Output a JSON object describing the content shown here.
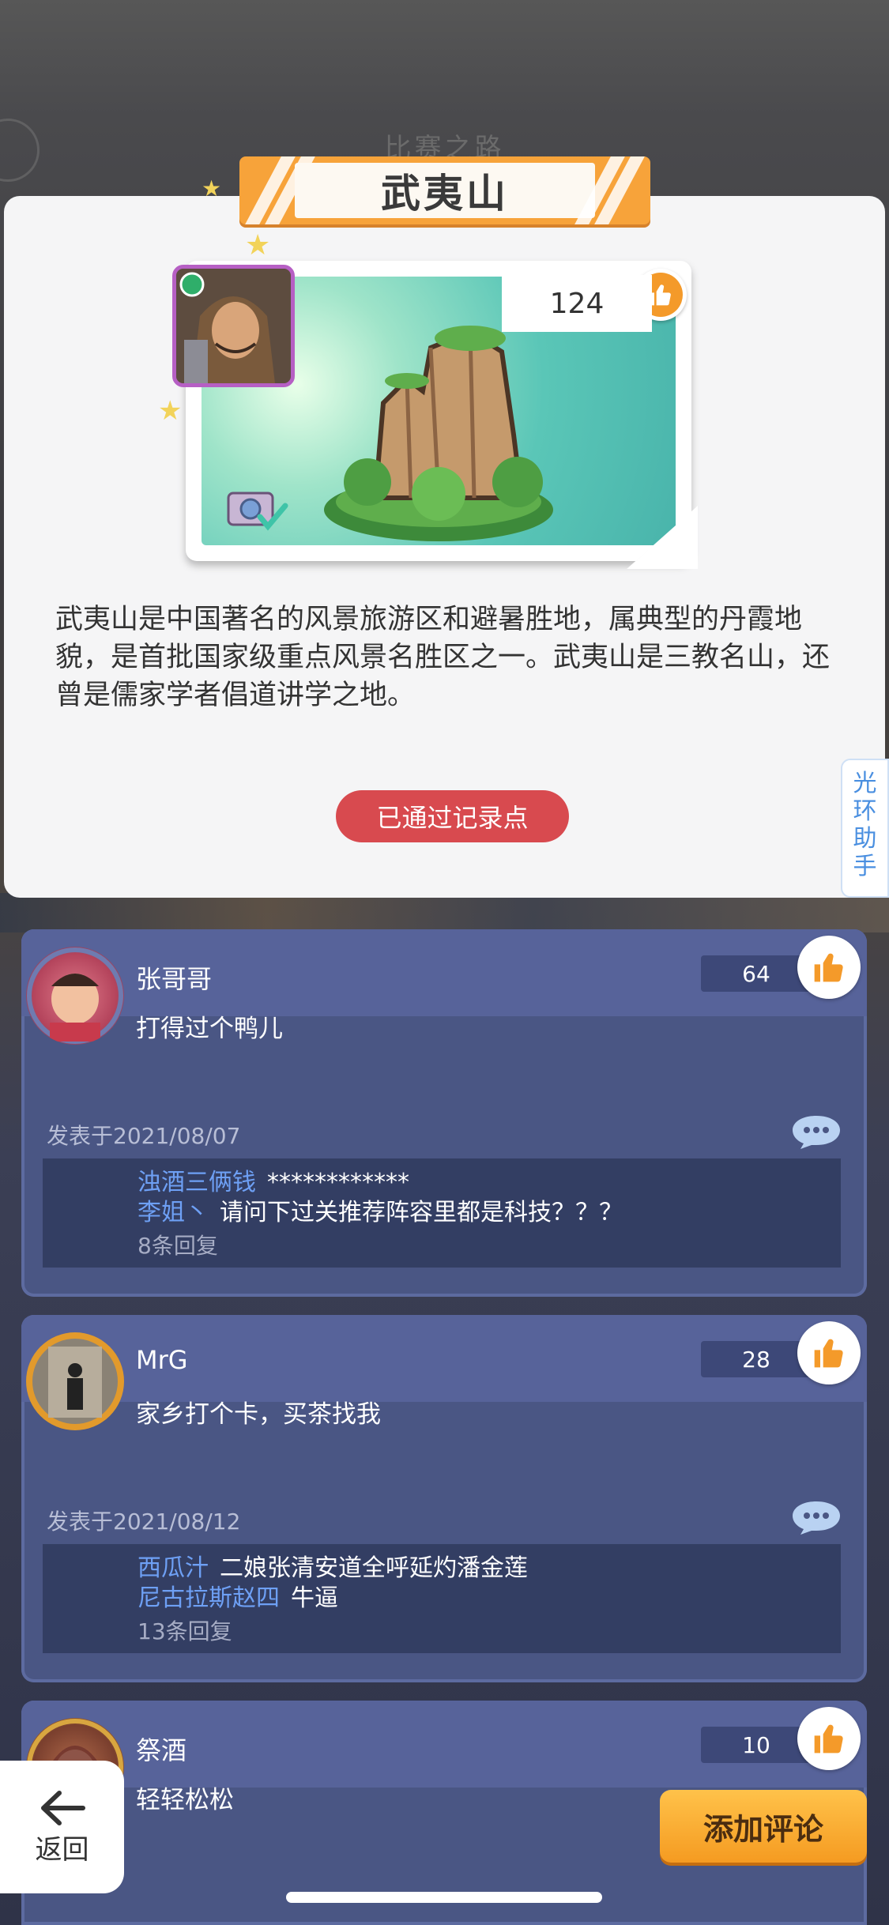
{
  "background": {
    "title": "比赛之路"
  },
  "location": {
    "title": "武夷山",
    "like_count": "124",
    "description": "武夷山是中国著名的风景旅游区和避暑胜地，属典型的丹霞地貌，是首批国家级重点风景名胜区之一。武夷山是三教名山，还曾是儒家学者倡道讲学之地。",
    "status_button": "已通过记录点"
  },
  "side_helper": {
    "label": "光环助手"
  },
  "comments": [
    {
      "name": "张哥哥",
      "likes": "64",
      "text": "打得过个鸭儿",
      "date": "发表于2021/08/07",
      "replies": [
        {
          "who": "浊酒三俩钱",
          "text": "************"
        },
        {
          "who": "李姐丶",
          "text": "请问下过关推荐阵容里都是科技？？？"
        }
      ],
      "reply_count": "8条回复"
    },
    {
      "name": "MrG",
      "likes": "28",
      "text": "家乡打个卡，买茶找我",
      "date": "发表于2021/08/12",
      "replies": [
        {
          "who": "西瓜汁",
          "text": "二娘张清安道全呼延灼潘金莲"
        },
        {
          "who": "尼古拉斯赵四",
          "text": "牛逼"
        }
      ],
      "reply_count": "13条回复"
    },
    {
      "name": "祭酒",
      "likes": "10",
      "text": "轻轻松松"
    }
  ],
  "controls": {
    "back_label": "返回",
    "add_comment_label": "添加评论"
  },
  "colors": {
    "accent_orange": "#f49a2a",
    "passed_red": "#d84a4f",
    "comment_bg": "#4a5684",
    "reply_name": "#6ea0f5"
  }
}
